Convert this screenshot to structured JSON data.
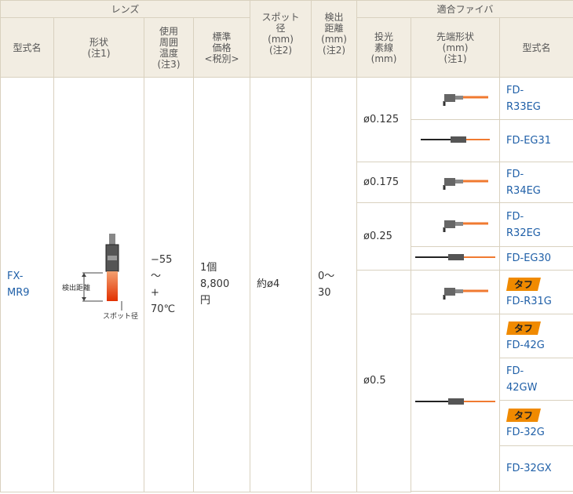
{
  "header": {
    "lens_group": "レンズ",
    "fiber_group": "適合ファイバ",
    "model_name": "型式名",
    "shape": "形状\n(注1)",
    "temp": "使用\n周囲\n温度\n(注3)",
    "price": "標準\n価格\n<税別>",
    "spot": "スポット\n径\n(mm)\n(注2)",
    "distance": "検出\n距離\n(mm)\n(注2)",
    "core": "投光\n素線\n(mm)",
    "tip_shape": "先端形状\n(mm)\n(注1)",
    "fiber_model": "型式名"
  },
  "lens": {
    "model": "FX-\nMR9",
    "temp": "−55\n〜\n+\n70℃",
    "price": "1個\n8,800\n円",
    "spot": "約ø4",
    "distance": "0〜\n30",
    "diagram_label_distance": "検出距離",
    "diagram_label_spot": "スポット径"
  },
  "fibers": [
    {
      "core": "ø0.125",
      "items": [
        {
          "model": "FD-\nR33EG",
          "tip": "right-angle",
          "badge": false
        },
        {
          "model": "FD-EG31",
          "tip": "straight-long",
          "badge": false
        }
      ]
    },
    {
      "core": "ø0.175",
      "items": [
        {
          "model": "FD-\nR34EG",
          "tip": "right-angle",
          "badge": false
        }
      ]
    },
    {
      "core": "ø0.25",
      "items": [
        {
          "model": "FD-\nR32EG",
          "tip": "right-angle",
          "badge": false
        },
        {
          "model": "FD-EG30",
          "tip": "straight-long",
          "badge": false
        }
      ]
    },
    {
      "core": "ø0.5",
      "items": [
        {
          "model": "FD-R31G",
          "tip": "right-angle",
          "badge": true
        },
        {
          "model": "FD-42G",
          "tip": "straight-long",
          "badge": true
        },
        {
          "model": "FD-\n42GW",
          "tip": "",
          "badge": false
        },
        {
          "model": "FD-32G",
          "tip": "",
          "badge": true
        },
        {
          "model": "FD-32GX",
          "tip": "",
          "badge": false
        }
      ]
    }
  ],
  "badge_text": "タフ",
  "colors": {
    "header_bg": "#f2ede2",
    "border": "#d9d1bf",
    "link": "#2060a8",
    "badge": "#f08a00"
  }
}
